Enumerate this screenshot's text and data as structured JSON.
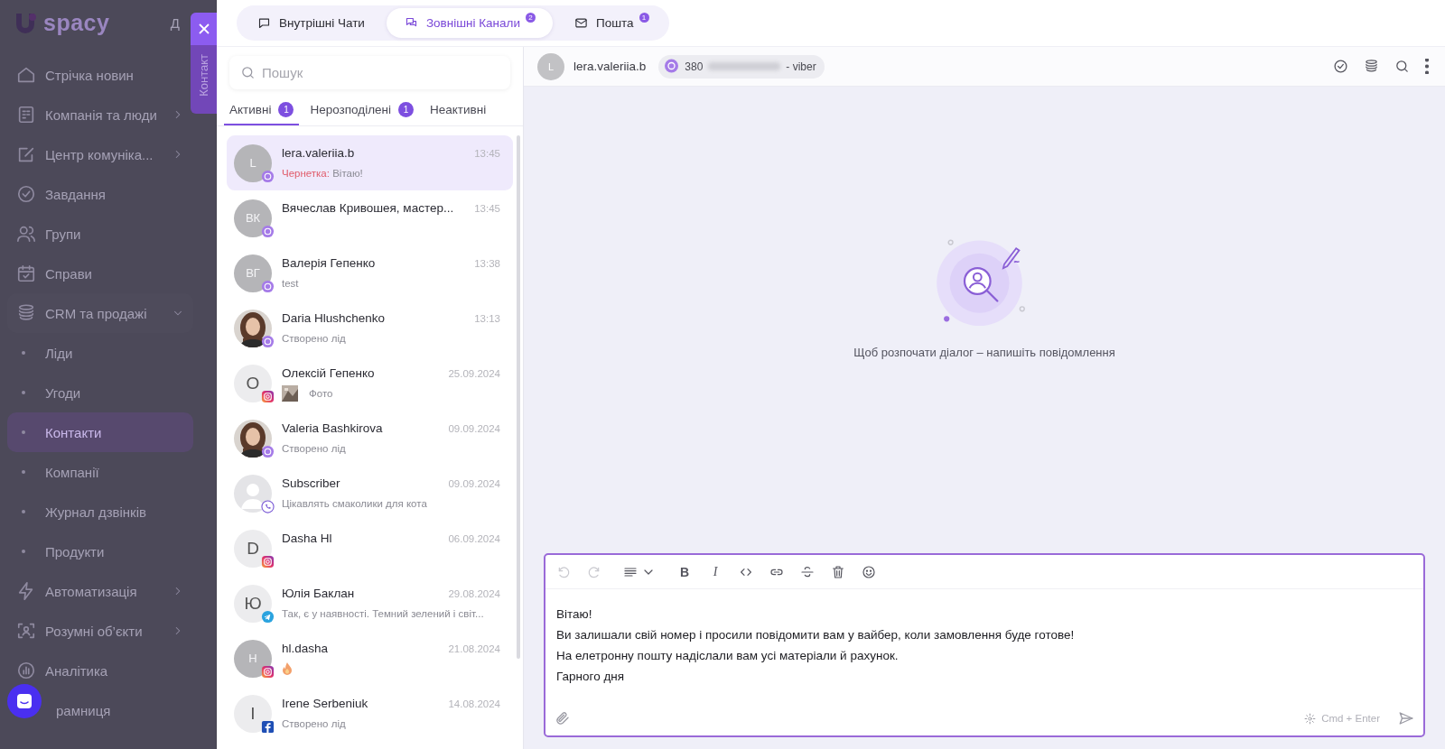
{
  "sidebar": {
    "logo": "spacy",
    "corner_letter": "Д",
    "items": [
      {
        "kind": "section",
        "label": "Стрічка новин",
        "selected": false
      },
      {
        "kind": "section",
        "label": "Компанія та люди",
        "expanded": false,
        "selected": false
      },
      {
        "kind": "section",
        "label": "Центр комуніка...",
        "expanded": false,
        "selected": false
      },
      {
        "kind": "section",
        "label": "Завдання",
        "selected": false
      },
      {
        "kind": "section",
        "label": "Групи",
        "selected": false
      },
      {
        "kind": "section",
        "label": "Справи",
        "selected": false
      },
      {
        "kind": "section",
        "label": "CRM та продажі",
        "expanded": true,
        "selected": false
      },
      {
        "kind": "subitem",
        "label": "Ліди",
        "selected": false
      },
      {
        "kind": "subitem",
        "label": "Угоди",
        "selected": false
      },
      {
        "kind": "subitem",
        "label": "Контакти",
        "selected": true
      },
      {
        "kind": "subitem",
        "label": "Компанії",
        "selected": false
      },
      {
        "kind": "subitem",
        "label": "Журнал дзвінків",
        "selected": false
      },
      {
        "kind": "subitem",
        "label": "Продукти",
        "selected": false
      },
      {
        "kind": "section",
        "label": "Автоматизація",
        "expanded": false,
        "selected": false
      },
      {
        "kind": "section",
        "label": "Розумні об’єкти",
        "expanded": false,
        "selected": false
      },
      {
        "kind": "section",
        "label": "Аналітика",
        "selected": false
      },
      {
        "kind": "section",
        "label": "рамниця",
        "selected": false
      }
    ]
  },
  "contact_tab": {
    "label": "Контакт"
  },
  "top_tabs": [
    {
      "label": "Внутрішні Чати",
      "selected": false
    },
    {
      "label": "Зовнішні Канали",
      "selected": true,
      "badge": "2"
    },
    {
      "label": "Пошта",
      "selected": false,
      "badge": "1"
    }
  ],
  "search": {
    "placeholder": "Пошук"
  },
  "filters": [
    {
      "label": "Активні",
      "badge": "1",
      "selected": true
    },
    {
      "label": "Нерозподілені",
      "badge": "1",
      "selected": false
    },
    {
      "label": "Неактивні",
      "selected": false
    }
  ],
  "chats": [
    {
      "avatar": {
        "kind": "initials",
        "text": "L",
        "filled": true
      },
      "channel": {
        "kind": "viber-chat"
      },
      "name": "lera.valeriia.b",
      "time": "13:45",
      "draft_label": "Чернетка:",
      "preview": "Вітаю!",
      "selected": true
    },
    {
      "avatar": {
        "kind": "initials",
        "text": "ВК",
        "filled": true
      },
      "channel": {
        "kind": "viber-chat"
      },
      "name": "Вячеслав Кривошея, мастер...",
      "time": "13:45",
      "selected": false
    },
    {
      "avatar": {
        "kind": "initials",
        "text": "ВГ",
        "filled": true
      },
      "channel": {
        "kind": "viber-chat"
      },
      "name": "Валерія Гепенко",
      "time": "13:38",
      "preview": "test",
      "selected": false
    },
    {
      "channel": {
        "kind": "viber-chat"
      },
      "name": "Daria Hlushchenko",
      "time": "13:13",
      "preview": "Створено лід",
      "selected": false
    },
    {
      "avatar": {
        "kind": "initials",
        "text": "О",
        "filled": false
      },
      "channel": {
        "kind": "instagram"
      },
      "name": "Олексій Гепенко",
      "time": "25.09.2024",
      "preview": "Фото",
      "selected": false
    },
    {
      "channel": {
        "kind": "viber-chat"
      },
      "name": "Valeria Bashkirova",
      "time": "09.09.2024",
      "preview": "Створено лід",
      "selected": false
    },
    {
      "avatar": {
        "kind": "placeholder"
      },
      "channel": {
        "kind": "viber"
      },
      "name": "Subscriber",
      "time": "09.09.2024",
      "preview": "Цікавлять смаколики для кота",
      "selected": false
    },
    {
      "avatar": {
        "kind": "initials",
        "text": "D",
        "filled": false
      },
      "channel": {
        "kind": "instagram"
      },
      "name": "Dasha Hl",
      "time": "06.09.2024",
      "selected": false
    },
    {
      "avatar": {
        "kind": "initials",
        "text": "Ю",
        "filled": false
      },
      "channel": {
        "kind": "telegram"
      },
      "name": "Юлія Баклан",
      "time": "29.08.2024",
      "preview": "Так, є у наявності. Темний зелений і світ...",
      "selected": false
    },
    {
      "avatar": {
        "kind": "initials",
        "text": "H",
        "filled": true
      },
      "channel": {
        "kind": "instagram"
      },
      "name": "hl.dasha",
      "time": "21.08.2024",
      "preview_media": {
        "kind": "fire"
      },
      "selected": false
    },
    {
      "avatar": {
        "kind": "initials",
        "text": "I",
        "filled": false
      },
      "channel": {
        "kind": "facebook"
      },
      "name": "Irene Serbeniuk",
      "time": "14.08.2024",
      "preview": "Створено лід",
      "selected": false
    }
  ],
  "chat_header": {
    "avatar": "L",
    "name": "lera.valeriia.b",
    "phone_prefix": "380",
    "channel_suffix": "- viber"
  },
  "empty_state": {
    "message": "Щоб розпочати діалог – напишіть повідомлення"
  },
  "editor": {
    "toolbar": [
      {
        "kind": "undo",
        "disabled": true
      },
      {
        "kind": "redo",
        "disabled": true
      },
      {
        "kind": "align",
        "disabled": false
      },
      {
        "kind": "bold",
        "label": "B",
        "disabled": false
      },
      {
        "kind": "italic",
        "label": "I",
        "disabled": false
      },
      {
        "kind": "code",
        "disabled": false
      },
      {
        "kind": "link",
        "disabled": false
      },
      {
        "kind": "strike",
        "disabled": false
      },
      {
        "kind": "delete",
        "disabled": false
      },
      {
        "kind": "emoji",
        "disabled": false
      }
    ],
    "lines": [
      "Вітаю!",
      "Ви залишали свій номер і просили повідомити вам у вайбер, коли замовлення буде готове!",
      "На елетронну пошту надіслали вам усі матеріали й рахунок.",
      "Гарного дня"
    ],
    "shortcut": "Cmd + Enter"
  }
}
